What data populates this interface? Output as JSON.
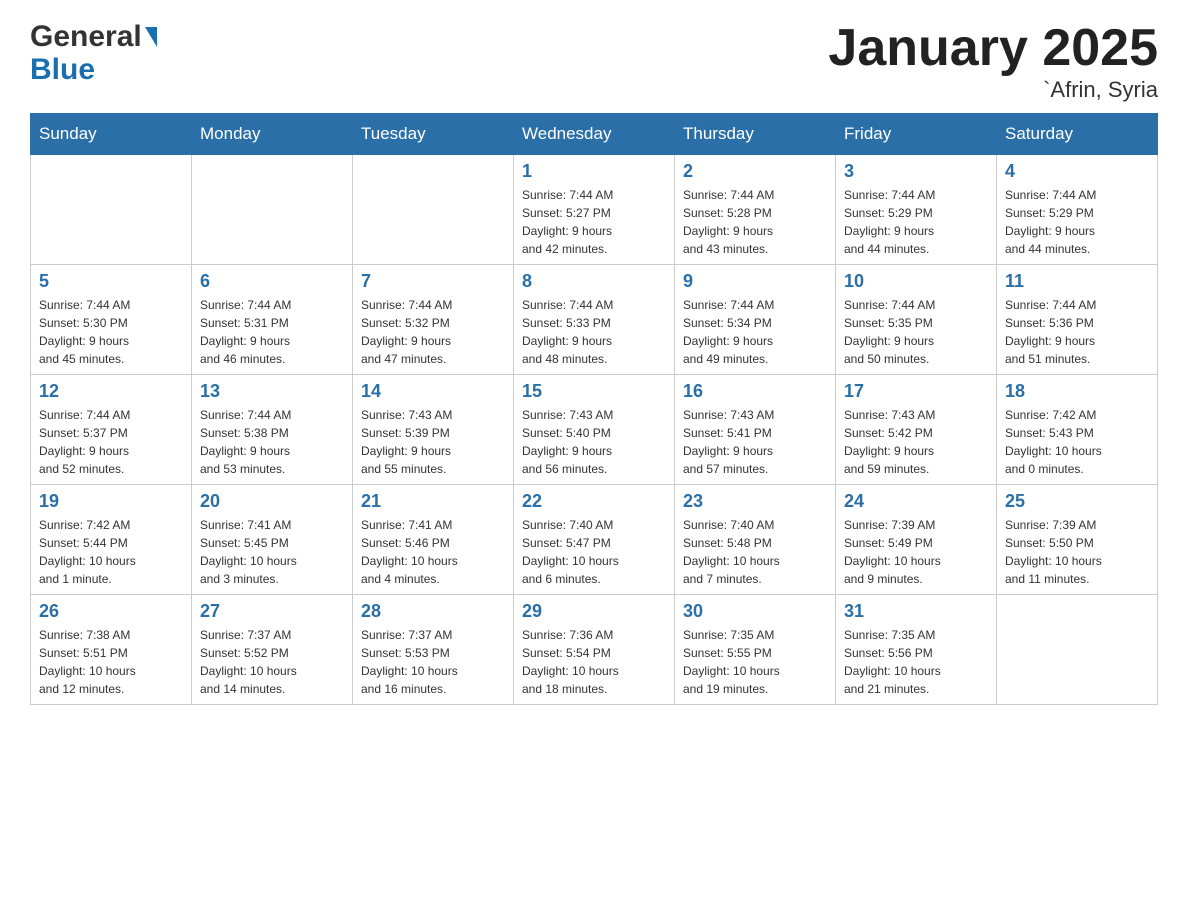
{
  "header": {
    "title": "January 2025",
    "subtitle": "`Afrin, Syria",
    "logo_general": "General",
    "logo_blue": "Blue"
  },
  "weekdays": [
    "Sunday",
    "Monday",
    "Tuesday",
    "Wednesday",
    "Thursday",
    "Friday",
    "Saturday"
  ],
  "weeks": [
    [
      {
        "day": "",
        "info": ""
      },
      {
        "day": "",
        "info": ""
      },
      {
        "day": "",
        "info": ""
      },
      {
        "day": "1",
        "info": "Sunrise: 7:44 AM\nSunset: 5:27 PM\nDaylight: 9 hours\nand 42 minutes."
      },
      {
        "day": "2",
        "info": "Sunrise: 7:44 AM\nSunset: 5:28 PM\nDaylight: 9 hours\nand 43 minutes."
      },
      {
        "day": "3",
        "info": "Sunrise: 7:44 AM\nSunset: 5:29 PM\nDaylight: 9 hours\nand 44 minutes."
      },
      {
        "day": "4",
        "info": "Sunrise: 7:44 AM\nSunset: 5:29 PM\nDaylight: 9 hours\nand 44 minutes."
      }
    ],
    [
      {
        "day": "5",
        "info": "Sunrise: 7:44 AM\nSunset: 5:30 PM\nDaylight: 9 hours\nand 45 minutes."
      },
      {
        "day": "6",
        "info": "Sunrise: 7:44 AM\nSunset: 5:31 PM\nDaylight: 9 hours\nand 46 minutes."
      },
      {
        "day": "7",
        "info": "Sunrise: 7:44 AM\nSunset: 5:32 PM\nDaylight: 9 hours\nand 47 minutes."
      },
      {
        "day": "8",
        "info": "Sunrise: 7:44 AM\nSunset: 5:33 PM\nDaylight: 9 hours\nand 48 minutes."
      },
      {
        "day": "9",
        "info": "Sunrise: 7:44 AM\nSunset: 5:34 PM\nDaylight: 9 hours\nand 49 minutes."
      },
      {
        "day": "10",
        "info": "Sunrise: 7:44 AM\nSunset: 5:35 PM\nDaylight: 9 hours\nand 50 minutes."
      },
      {
        "day": "11",
        "info": "Sunrise: 7:44 AM\nSunset: 5:36 PM\nDaylight: 9 hours\nand 51 minutes."
      }
    ],
    [
      {
        "day": "12",
        "info": "Sunrise: 7:44 AM\nSunset: 5:37 PM\nDaylight: 9 hours\nand 52 minutes."
      },
      {
        "day": "13",
        "info": "Sunrise: 7:44 AM\nSunset: 5:38 PM\nDaylight: 9 hours\nand 53 minutes."
      },
      {
        "day": "14",
        "info": "Sunrise: 7:43 AM\nSunset: 5:39 PM\nDaylight: 9 hours\nand 55 minutes."
      },
      {
        "day": "15",
        "info": "Sunrise: 7:43 AM\nSunset: 5:40 PM\nDaylight: 9 hours\nand 56 minutes."
      },
      {
        "day": "16",
        "info": "Sunrise: 7:43 AM\nSunset: 5:41 PM\nDaylight: 9 hours\nand 57 minutes."
      },
      {
        "day": "17",
        "info": "Sunrise: 7:43 AM\nSunset: 5:42 PM\nDaylight: 9 hours\nand 59 minutes."
      },
      {
        "day": "18",
        "info": "Sunrise: 7:42 AM\nSunset: 5:43 PM\nDaylight: 10 hours\nand 0 minutes."
      }
    ],
    [
      {
        "day": "19",
        "info": "Sunrise: 7:42 AM\nSunset: 5:44 PM\nDaylight: 10 hours\nand 1 minute."
      },
      {
        "day": "20",
        "info": "Sunrise: 7:41 AM\nSunset: 5:45 PM\nDaylight: 10 hours\nand 3 minutes."
      },
      {
        "day": "21",
        "info": "Sunrise: 7:41 AM\nSunset: 5:46 PM\nDaylight: 10 hours\nand 4 minutes."
      },
      {
        "day": "22",
        "info": "Sunrise: 7:40 AM\nSunset: 5:47 PM\nDaylight: 10 hours\nand 6 minutes."
      },
      {
        "day": "23",
        "info": "Sunrise: 7:40 AM\nSunset: 5:48 PM\nDaylight: 10 hours\nand 7 minutes."
      },
      {
        "day": "24",
        "info": "Sunrise: 7:39 AM\nSunset: 5:49 PM\nDaylight: 10 hours\nand 9 minutes."
      },
      {
        "day": "25",
        "info": "Sunrise: 7:39 AM\nSunset: 5:50 PM\nDaylight: 10 hours\nand 11 minutes."
      }
    ],
    [
      {
        "day": "26",
        "info": "Sunrise: 7:38 AM\nSunset: 5:51 PM\nDaylight: 10 hours\nand 12 minutes."
      },
      {
        "day": "27",
        "info": "Sunrise: 7:37 AM\nSunset: 5:52 PM\nDaylight: 10 hours\nand 14 minutes."
      },
      {
        "day": "28",
        "info": "Sunrise: 7:37 AM\nSunset: 5:53 PM\nDaylight: 10 hours\nand 16 minutes."
      },
      {
        "day": "29",
        "info": "Sunrise: 7:36 AM\nSunset: 5:54 PM\nDaylight: 10 hours\nand 18 minutes."
      },
      {
        "day": "30",
        "info": "Sunrise: 7:35 AM\nSunset: 5:55 PM\nDaylight: 10 hours\nand 19 minutes."
      },
      {
        "day": "31",
        "info": "Sunrise: 7:35 AM\nSunset: 5:56 PM\nDaylight: 10 hours\nand 21 minutes."
      },
      {
        "day": "",
        "info": ""
      }
    ]
  ]
}
